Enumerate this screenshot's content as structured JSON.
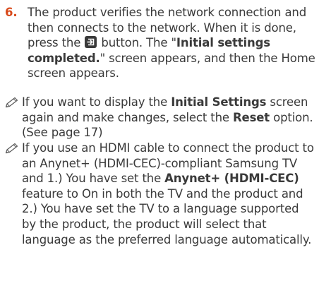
{
  "step": {
    "number": "6.",
    "text_a": "The product verifies the network connection and then connects to the network. When it is done, press the ",
    "icon": "enter-button-icon",
    "text_b": " button. The \"",
    "bold_a": "Initial settings completed.",
    "text_c": "\" screen appears, and then the Home screen appears."
  },
  "notes": [
    {
      "icon": "pencil-note-icon",
      "t1": "If you want to display the ",
      "b1": "Initial Settings",
      "t2": " screen again and make changes, select the ",
      "b2": "Reset",
      "t3": " option. (See page 17)"
    },
    {
      "icon": "pencil-note-icon",
      "t1": "If you use an HDMI cable to connect the product to an Anynet+ (HDMI-CEC)-compliant Samsung TV and 1.) You have set the ",
      "b1": "Anynet+ (HDMI-CEC)",
      "t2": " feature to On in both the TV and the product and 2.) You have set the TV to a language supported by the product, the product will select that language as the preferred language automatically."
    }
  ],
  "colors": {
    "step_number": "#d84a1b",
    "text": "#3a3a3a"
  }
}
